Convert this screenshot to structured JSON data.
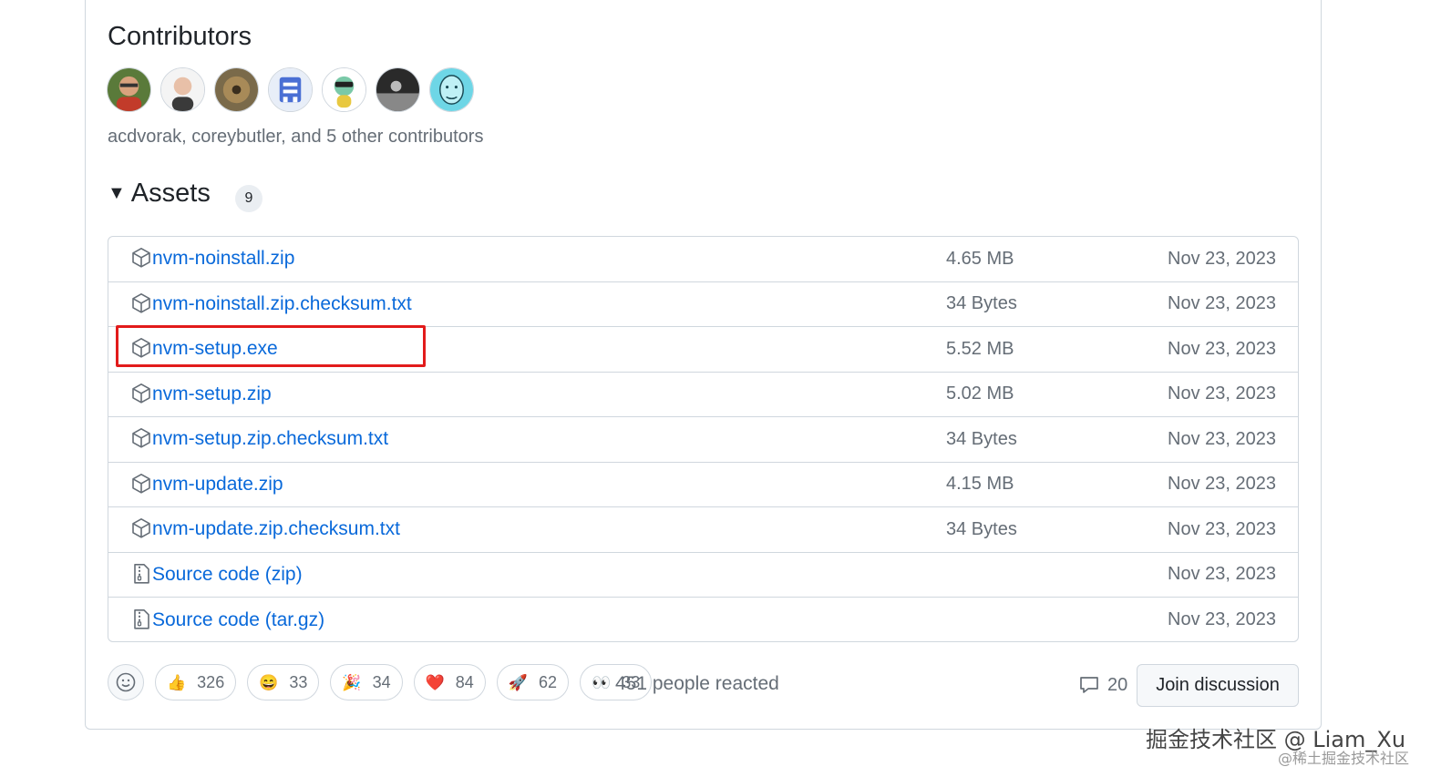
{
  "contributors": {
    "title": "Contributors",
    "summary": "acdvorak, coreybutler, and 5 other contributors",
    "avatars": [
      "avatar-acdvorak",
      "avatar-coreybutler",
      "avatar-3",
      "avatar-4",
      "avatar-5",
      "avatar-6",
      "avatar-7"
    ]
  },
  "assets": {
    "title": "Assets",
    "count": "9",
    "items": [
      {
        "name": "nvm-noinstall.zip",
        "suffix": "",
        "size": "4.65 MB",
        "date": "Nov 23, 2023",
        "icon": "package-icon"
      },
      {
        "name": "nvm-noinstall.zip.checksum.txt",
        "suffix": "",
        "size": "34 Bytes",
        "date": "Nov 23, 2023",
        "icon": "package-icon"
      },
      {
        "name": "nvm-setup.exe",
        "suffix": "",
        "size": "5.52 MB",
        "date": "Nov 23, 2023",
        "icon": "package-icon"
      },
      {
        "name": "nvm-setup.zip",
        "suffix": "",
        "size": "5.02 MB",
        "date": "Nov 23, 2023",
        "icon": "package-icon"
      },
      {
        "name": "nvm-setup.zip.checksum.txt",
        "suffix": "",
        "size": "34 Bytes",
        "date": "Nov 23, 2023",
        "icon": "package-icon"
      },
      {
        "name": "nvm-update.zip",
        "suffix": "",
        "size": "4.15 MB",
        "date": "Nov 23, 2023",
        "icon": "package-icon"
      },
      {
        "name": "nvm-update.zip.checksum.txt",
        "suffix": "",
        "size": "34 Bytes",
        "date": "Nov 23, 2023",
        "icon": "package-icon"
      },
      {
        "name": "Source code",
        "suffix": " (zip)",
        "size": "",
        "date": "Nov 23, 2023",
        "icon": "file-zip-icon"
      },
      {
        "name": "Source code",
        "suffix": " (tar.gz)",
        "size": "",
        "date": "Nov 23, 2023",
        "icon": "file-zip-icon"
      }
    ]
  },
  "reactions": {
    "items": [
      {
        "emoji": "👍",
        "count": "326",
        "name": "thumbs-up"
      },
      {
        "emoji": "😄",
        "count": "33",
        "name": "laugh"
      },
      {
        "emoji": "🎉",
        "count": "34",
        "name": "hooray"
      },
      {
        "emoji": "❤️",
        "count": "84",
        "name": "heart"
      },
      {
        "emoji": "🚀",
        "count": "62",
        "name": "rocket"
      },
      {
        "emoji": "👀",
        "count": "33",
        "name": "eyes"
      }
    ],
    "summary": "451 people reacted"
  },
  "discussion": {
    "comment_count": "20",
    "join_label": "Join discussion"
  },
  "watermark": {
    "line1": "掘金技术社区 @ Liam_Xu",
    "line2": "@稀土掘金技术社区"
  },
  "colors": {
    "link": "#0969da",
    "muted": "#656d76",
    "border": "#d0d7de",
    "highlight": "#e21b1b"
  }
}
